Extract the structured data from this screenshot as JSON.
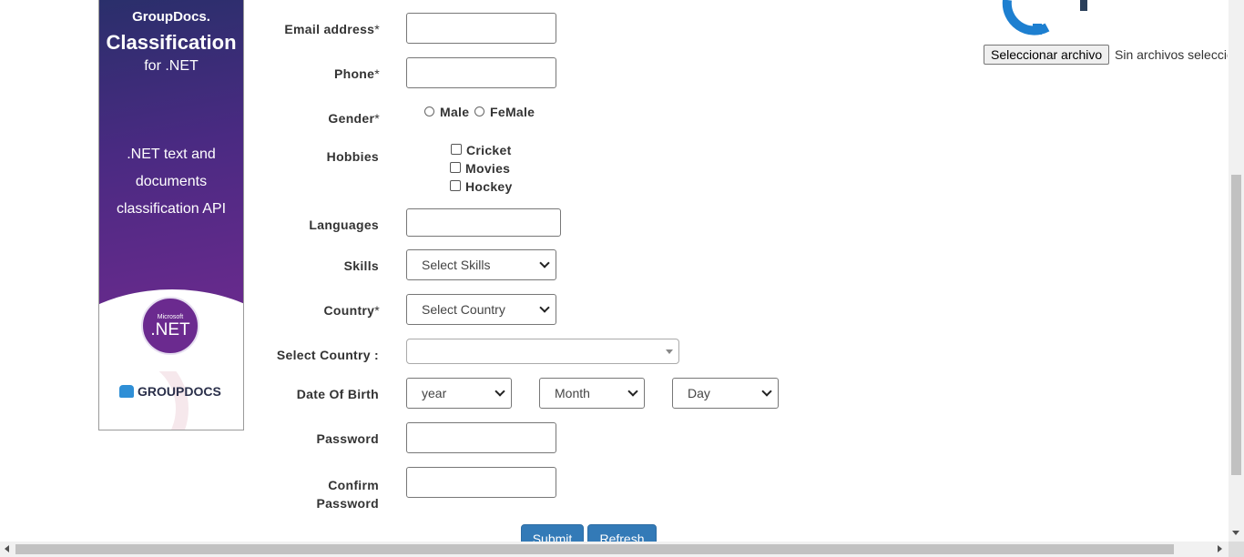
{
  "ad": {
    "brand_top": "GroupDocs.",
    "product": "Classification",
    "platform": "for .NET",
    "description": ".NET text and documents classification API",
    "badge_small": "Microsoft",
    "badge_large": ".NET",
    "brand_bottom": "GROUPDOCS"
  },
  "form": {
    "email_label": "Email address",
    "phone_label": "Phone",
    "gender_label": "Gender",
    "gender_options": [
      "Male",
      "FeMale"
    ],
    "hobbies_label": "Hobbies",
    "hobbies": [
      "Cricket",
      "Movies",
      "Hockey"
    ],
    "languages_label": "Languages",
    "skills_label": "Skills",
    "skills_selected": "Select Skills",
    "country_label": "Country",
    "country_selected": "Select Country",
    "select_country_label": "Select Country :",
    "dob_label": "Date Of Birth",
    "dob_year": "year",
    "dob_month": "Month",
    "dob_day": "Day",
    "password_label": "Password",
    "confirm_password_label_1": "Confirm",
    "confirm_password_label_2": "Password",
    "required_mark": "*",
    "submit_label": "Submit",
    "refresh_label": "Refresh"
  },
  "upload": {
    "button_label": "Seleccionar archivo",
    "status_text": "Sin archivos seleccionados"
  },
  "colors": {
    "primary_button": "#337ab7",
    "gear_logo": "#1d7fd0"
  }
}
